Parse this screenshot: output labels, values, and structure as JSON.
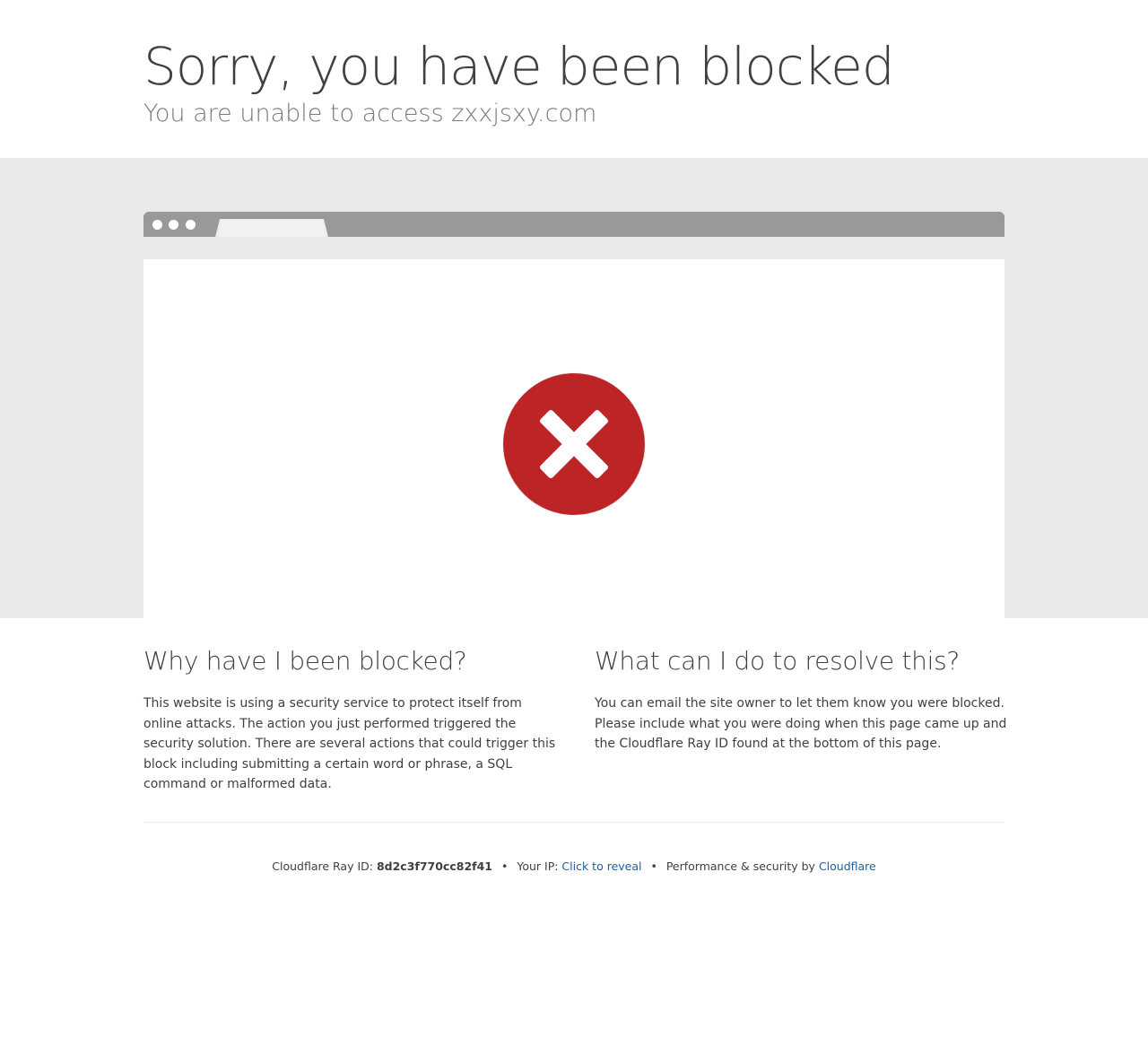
{
  "header": {
    "title": "Sorry, you have been blocked",
    "subtitle": "You are unable to access zxxjsxy.com"
  },
  "error_icon": "close-circle-icon",
  "colors": {
    "error_red": "#bd2426",
    "link_blue": "#1f5fa0",
    "band_gray": "#eaeaea",
    "bar_gray": "#999999"
  },
  "why": {
    "heading": "Why have I been blocked?",
    "body": "This website is using a security service to protect itself from online attacks. The action you just performed triggered the security solution. There are several actions that could trigger this block including submitting a certain word or phrase, a SQL command or malformed data."
  },
  "resolve": {
    "heading": "What can I do to resolve this?",
    "body": "You can email the site owner to let them know you were blocked. Please include what you were doing when this page came up and the Cloudflare Ray ID found at the bottom of this page."
  },
  "footer": {
    "ray_label": "Cloudflare Ray ID:",
    "ray_id": "8d2c3f770cc82f41",
    "separator": "•",
    "ip_label": "Your IP:",
    "ip_link": "Click to reveal",
    "perf_label": "Performance & security by",
    "brand_link": "Cloudflare"
  }
}
